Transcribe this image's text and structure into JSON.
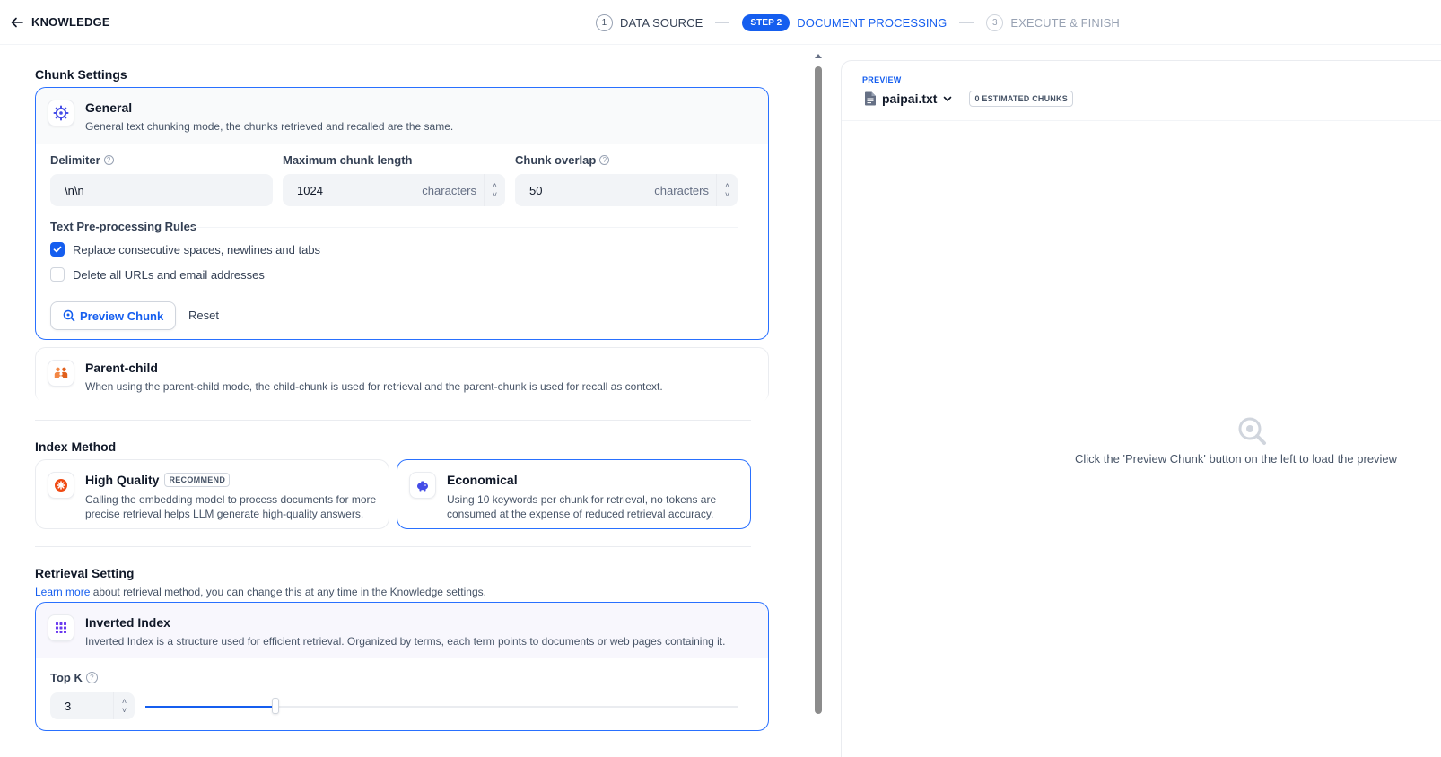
{
  "header": {
    "brand": "KNOWLEDGE",
    "steps": [
      {
        "num": "1",
        "label": "DATA SOURCE"
      },
      {
        "pill": "STEP 2",
        "label": "DOCUMENT PROCESSING"
      },
      {
        "num": "3",
        "label": "EXECUTE & FINISH"
      }
    ]
  },
  "chunk": {
    "section_title": "Chunk Settings",
    "general": {
      "title": "General",
      "desc": "General text chunking mode, the chunks retrieved and recalled are the same."
    },
    "delimiter": {
      "label": "Delimiter",
      "value": "\\n\\n"
    },
    "max_length": {
      "label": "Maximum chunk length",
      "value": "1024",
      "suffix": "characters"
    },
    "overlap": {
      "label": "Chunk overlap",
      "value": "50",
      "suffix": "characters"
    },
    "rules": {
      "title": "Text Pre-processing Rules",
      "replace": {
        "label": "Replace consecutive spaces, newlines and tabs",
        "checked": true
      },
      "delete_urls": {
        "label": "Delete all URLs and email addresses",
        "checked": false
      }
    },
    "preview_button": "Preview Chunk",
    "reset_button": "Reset",
    "parent_child": {
      "title": "Parent-child",
      "desc": "When using the parent-child mode, the child-chunk is used for retrieval and the parent-chunk is used for recall as context."
    }
  },
  "index": {
    "section_title": "Index Method",
    "high_quality": {
      "title": "High Quality",
      "badge": "RECOMMEND",
      "desc": "Calling the embedding model to process documents for more precise retrieval helps LLM generate high-quality answers."
    },
    "economical": {
      "title": "Economical",
      "desc": "Using 10 keywords per chunk for retrieval, no tokens are consumed at the expense of reduced retrieval accuracy."
    }
  },
  "retrieval": {
    "section_title": "Retrieval Setting",
    "learn_link": "Learn more",
    "learn_rest": " about retrieval method, you can change this at any time in the Knowledge settings.",
    "inverted": {
      "title": "Inverted Index",
      "desc": "Inverted Index is a structure used for efficient retrieval. Organized by terms, each term points to documents or web pages containing it."
    },
    "top_k": {
      "label": "Top K",
      "value": "3",
      "slider_fraction": 0.22
    }
  },
  "preview": {
    "label": "PREVIEW",
    "file": "paipai.txt",
    "chunks_badge": "0 ESTIMATED CHUNKS",
    "empty_text": "Click the 'Preview Chunk' button on the left to load the preview"
  },
  "colors": {
    "accent": "#155eef",
    "active_border": "#2970ff"
  }
}
